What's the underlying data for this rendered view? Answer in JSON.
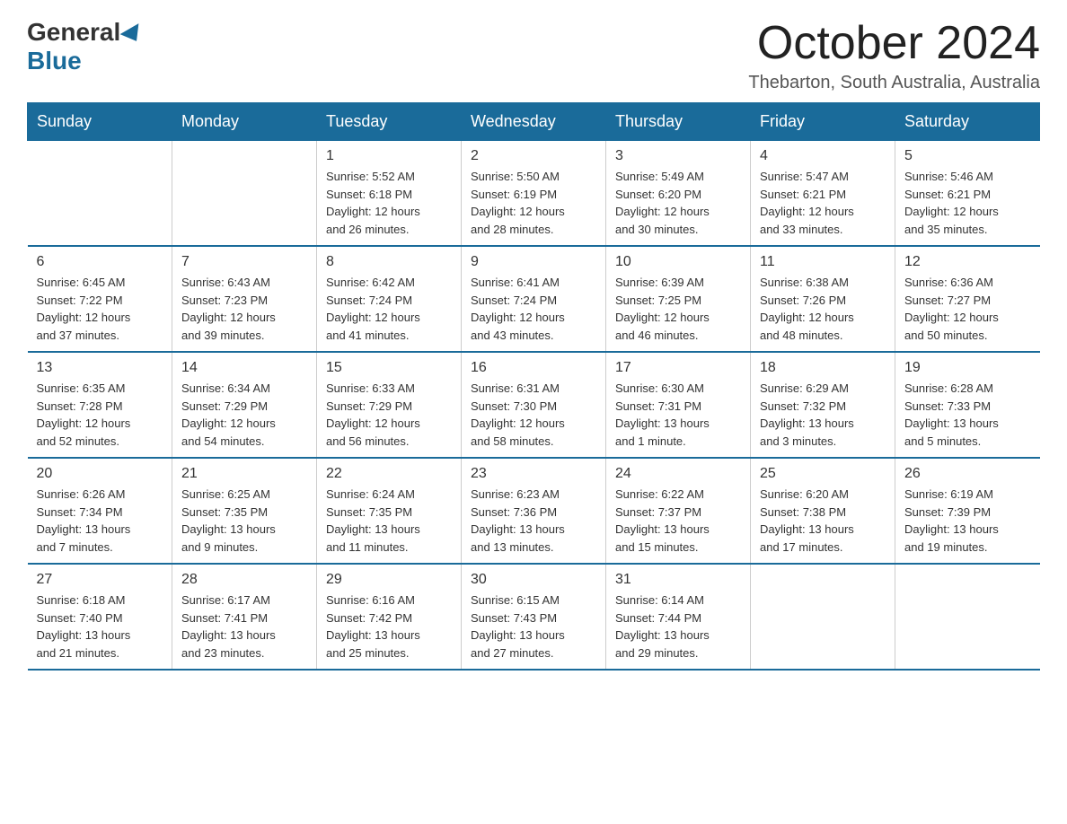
{
  "logo": {
    "general": "General",
    "blue": "Blue"
  },
  "header": {
    "month_year": "October 2024",
    "location": "Thebarton, South Australia, Australia"
  },
  "weekdays": [
    "Sunday",
    "Monday",
    "Tuesday",
    "Wednesday",
    "Thursday",
    "Friday",
    "Saturday"
  ],
  "weeks": [
    [
      {
        "day": "",
        "info": ""
      },
      {
        "day": "",
        "info": ""
      },
      {
        "day": "1",
        "info": "Sunrise: 5:52 AM\nSunset: 6:18 PM\nDaylight: 12 hours\nand 26 minutes."
      },
      {
        "day": "2",
        "info": "Sunrise: 5:50 AM\nSunset: 6:19 PM\nDaylight: 12 hours\nand 28 minutes."
      },
      {
        "day": "3",
        "info": "Sunrise: 5:49 AM\nSunset: 6:20 PM\nDaylight: 12 hours\nand 30 minutes."
      },
      {
        "day": "4",
        "info": "Sunrise: 5:47 AM\nSunset: 6:21 PM\nDaylight: 12 hours\nand 33 minutes."
      },
      {
        "day": "5",
        "info": "Sunrise: 5:46 AM\nSunset: 6:21 PM\nDaylight: 12 hours\nand 35 minutes."
      }
    ],
    [
      {
        "day": "6",
        "info": "Sunrise: 6:45 AM\nSunset: 7:22 PM\nDaylight: 12 hours\nand 37 minutes."
      },
      {
        "day": "7",
        "info": "Sunrise: 6:43 AM\nSunset: 7:23 PM\nDaylight: 12 hours\nand 39 minutes."
      },
      {
        "day": "8",
        "info": "Sunrise: 6:42 AM\nSunset: 7:24 PM\nDaylight: 12 hours\nand 41 minutes."
      },
      {
        "day": "9",
        "info": "Sunrise: 6:41 AM\nSunset: 7:24 PM\nDaylight: 12 hours\nand 43 minutes."
      },
      {
        "day": "10",
        "info": "Sunrise: 6:39 AM\nSunset: 7:25 PM\nDaylight: 12 hours\nand 46 minutes."
      },
      {
        "day": "11",
        "info": "Sunrise: 6:38 AM\nSunset: 7:26 PM\nDaylight: 12 hours\nand 48 minutes."
      },
      {
        "day": "12",
        "info": "Sunrise: 6:36 AM\nSunset: 7:27 PM\nDaylight: 12 hours\nand 50 minutes."
      }
    ],
    [
      {
        "day": "13",
        "info": "Sunrise: 6:35 AM\nSunset: 7:28 PM\nDaylight: 12 hours\nand 52 minutes."
      },
      {
        "day": "14",
        "info": "Sunrise: 6:34 AM\nSunset: 7:29 PM\nDaylight: 12 hours\nand 54 minutes."
      },
      {
        "day": "15",
        "info": "Sunrise: 6:33 AM\nSunset: 7:29 PM\nDaylight: 12 hours\nand 56 minutes."
      },
      {
        "day": "16",
        "info": "Sunrise: 6:31 AM\nSunset: 7:30 PM\nDaylight: 12 hours\nand 58 minutes."
      },
      {
        "day": "17",
        "info": "Sunrise: 6:30 AM\nSunset: 7:31 PM\nDaylight: 13 hours\nand 1 minute."
      },
      {
        "day": "18",
        "info": "Sunrise: 6:29 AM\nSunset: 7:32 PM\nDaylight: 13 hours\nand 3 minutes."
      },
      {
        "day": "19",
        "info": "Sunrise: 6:28 AM\nSunset: 7:33 PM\nDaylight: 13 hours\nand 5 minutes."
      }
    ],
    [
      {
        "day": "20",
        "info": "Sunrise: 6:26 AM\nSunset: 7:34 PM\nDaylight: 13 hours\nand 7 minutes."
      },
      {
        "day": "21",
        "info": "Sunrise: 6:25 AM\nSunset: 7:35 PM\nDaylight: 13 hours\nand 9 minutes."
      },
      {
        "day": "22",
        "info": "Sunrise: 6:24 AM\nSunset: 7:35 PM\nDaylight: 13 hours\nand 11 minutes."
      },
      {
        "day": "23",
        "info": "Sunrise: 6:23 AM\nSunset: 7:36 PM\nDaylight: 13 hours\nand 13 minutes."
      },
      {
        "day": "24",
        "info": "Sunrise: 6:22 AM\nSunset: 7:37 PM\nDaylight: 13 hours\nand 15 minutes."
      },
      {
        "day": "25",
        "info": "Sunrise: 6:20 AM\nSunset: 7:38 PM\nDaylight: 13 hours\nand 17 minutes."
      },
      {
        "day": "26",
        "info": "Sunrise: 6:19 AM\nSunset: 7:39 PM\nDaylight: 13 hours\nand 19 minutes."
      }
    ],
    [
      {
        "day": "27",
        "info": "Sunrise: 6:18 AM\nSunset: 7:40 PM\nDaylight: 13 hours\nand 21 minutes."
      },
      {
        "day": "28",
        "info": "Sunrise: 6:17 AM\nSunset: 7:41 PM\nDaylight: 13 hours\nand 23 minutes."
      },
      {
        "day": "29",
        "info": "Sunrise: 6:16 AM\nSunset: 7:42 PM\nDaylight: 13 hours\nand 25 minutes."
      },
      {
        "day": "30",
        "info": "Sunrise: 6:15 AM\nSunset: 7:43 PM\nDaylight: 13 hours\nand 27 minutes."
      },
      {
        "day": "31",
        "info": "Sunrise: 6:14 AM\nSunset: 7:44 PM\nDaylight: 13 hours\nand 29 minutes."
      },
      {
        "day": "",
        "info": ""
      },
      {
        "day": "",
        "info": ""
      }
    ]
  ]
}
